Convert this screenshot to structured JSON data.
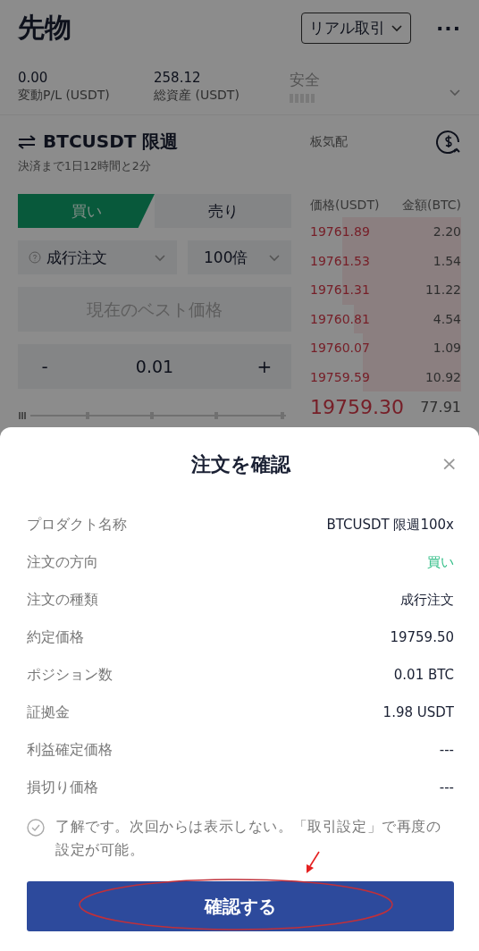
{
  "header": {
    "title": "先物",
    "mode_button": "リアル取引",
    "more": "···"
  },
  "stats": [
    {
      "value": "0.00",
      "label": "変動P/L (USDT)"
    },
    {
      "value": "258.12",
      "label": "総資産 (USDT)"
    }
  ],
  "risk": {
    "label": "安全"
  },
  "pair": {
    "symbol": "BTCUSDT 限週",
    "countdown": "決済まで1日12時間と2分"
  },
  "orderbook": {
    "title": "板気配",
    "columns": [
      "価格(USDT)",
      "金額(BTC)"
    ],
    "rows": [
      {
        "price": "19761.89",
        "amount": "2.20"
      },
      {
        "price": "19761.53",
        "amount": "1.54"
      },
      {
        "price": "19761.31",
        "amount": "11.22"
      },
      {
        "price": "19760.81",
        "amount": "4.54"
      },
      {
        "price": "19760.07",
        "amount": "1.09"
      },
      {
        "price": "19759.59",
        "amount": "10.92"
      }
    ],
    "last_price": "19759.30",
    "last_amount": "77.91"
  },
  "side_tabs": [
    {
      "label": "買い",
      "selected": true
    },
    {
      "label": "売り",
      "selected": false
    }
  ],
  "order_type": "成行注文",
  "leverage": "100倍",
  "price_field": {
    "placeholder": "現在のベスト価格"
  },
  "quantity": {
    "minus": "-",
    "value": "0.01",
    "plus": "+"
  },
  "dialog": {
    "title": "注文を確認",
    "close": "×",
    "rows": [
      {
        "label": "プロダクト名称",
        "value": "BTCUSDT 限週100x",
        "kind": "plain"
      },
      {
        "label": "注文の方向",
        "value": "買い",
        "kind": "buy"
      },
      {
        "label": "注文の種類",
        "value": "成行注文",
        "kind": "plain"
      },
      {
        "label": "約定価格",
        "value": "19759.50",
        "kind": "plain"
      },
      {
        "label": "ポジション数",
        "value": "0.01 BTC",
        "kind": "plain"
      },
      {
        "label": "証拠金",
        "value": "1.98 USDT",
        "kind": "plain"
      },
      {
        "label": "利益確定価格",
        "value": "---",
        "kind": "plain"
      },
      {
        "label": "損切り価格",
        "value": "---",
        "kind": "plain"
      }
    ],
    "dont_show": {
      "text": "了解です。次回からは表示しない。「取引設定」で再度の設定が可能。"
    },
    "confirm_button": "確認する"
  }
}
